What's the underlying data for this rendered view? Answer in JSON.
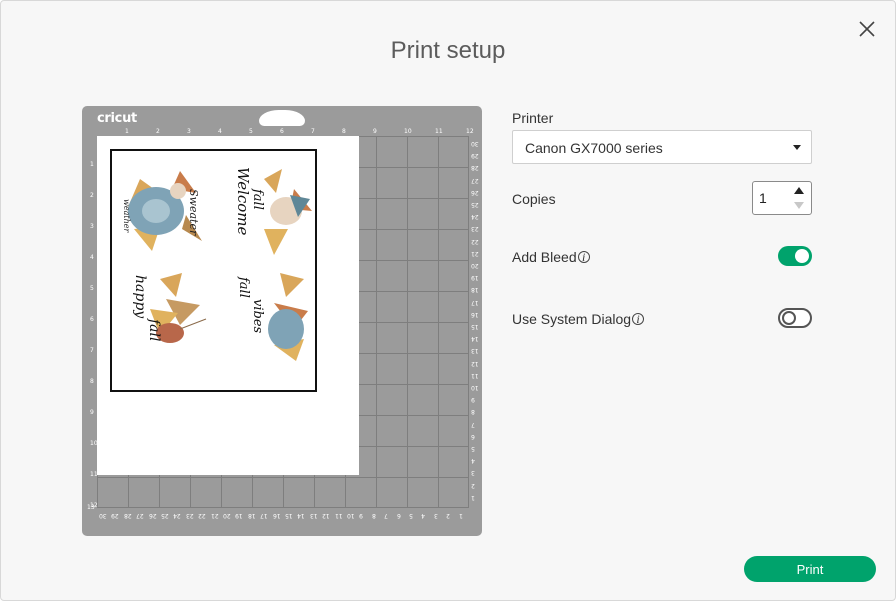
{
  "dialog": {
    "title": "Print setup",
    "close_icon": "close-icon"
  },
  "mat": {
    "brand": "cricut",
    "top_ticks": [
      "1",
      "2",
      "3",
      "4",
      "5",
      "6",
      "7",
      "8",
      "9",
      "10",
      "11",
      "12"
    ],
    "left_ticks": [
      "1",
      "2",
      "3",
      "4",
      "5",
      "6",
      "7",
      "8",
      "9",
      "10",
      "11",
      "12"
    ],
    "right_ticks": [
      "30",
      "29",
      "28",
      "27",
      "26",
      "25",
      "24",
      "23",
      "22",
      "21",
      "20",
      "19",
      "18",
      "17",
      "16",
      "15",
      "14",
      "13",
      "12",
      "11",
      "10",
      "9",
      "8",
      "7",
      "6",
      "5",
      "4",
      "3",
      "2",
      "1"
    ],
    "bottom_ticks": [
      "30",
      "29",
      "28",
      "27",
      "26",
      "25",
      "24",
      "23",
      "22",
      "21",
      "20",
      "19",
      "18",
      "17",
      "16",
      "15",
      "14",
      "13",
      "12",
      "11",
      "10",
      "9",
      "8",
      "7",
      "6",
      "5",
      "4",
      "3",
      "2",
      "1"
    ],
    "bottom_left_tick": "13"
  },
  "artwork": {
    "stickers": [
      {
        "script": "Sweater weather",
        "flower_color": "#7fa3b6"
      },
      {
        "script": "Welcome fall",
        "flower_color": "#7fa3b6"
      },
      {
        "script": "happy fall",
        "flower_color": "#c69a62"
      },
      {
        "script": "fall vibes",
        "flower_color": "#7fa3b6"
      }
    ]
  },
  "settings": {
    "printer": {
      "label": "Printer",
      "value": "Canon GX7000 series"
    },
    "copies": {
      "label": "Copies",
      "value": "1"
    },
    "add_bleed": {
      "label": "Add Bleed",
      "enabled": true
    },
    "use_system_dialog": {
      "label": "Use System Dialog",
      "enabled": false
    }
  },
  "actions": {
    "print_label": "Print"
  },
  "colors": {
    "accent": "#00a36c",
    "mat": "#9b9b9b"
  }
}
